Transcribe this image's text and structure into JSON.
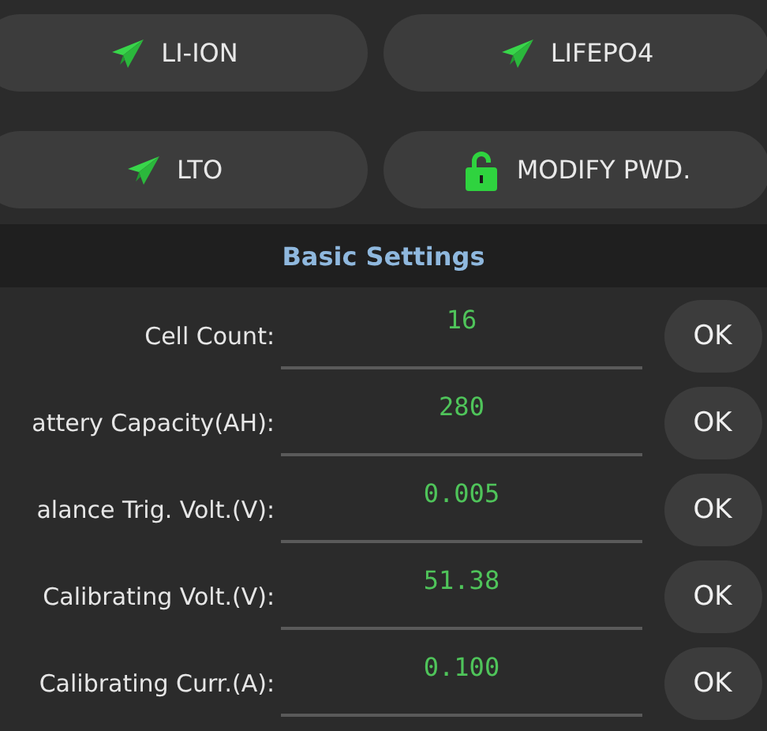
{
  "mode_buttons": [
    {
      "label": "LI-ION",
      "kind": "plane"
    },
    {
      "label": "LIFEPO4",
      "kind": "plane"
    },
    {
      "label": "LTO",
      "kind": "plane"
    },
    {
      "label": "MODIFY PWD.",
      "kind": "lock"
    }
  ],
  "section_title": "Basic Settings",
  "settings": [
    {
      "label": "Cell Count:",
      "value": "16",
      "button": "OK"
    },
    {
      "label": "attery Capacity(AH):",
      "value": "280",
      "button": "OK"
    },
    {
      "label": "alance Trig. Volt.(V):",
      "value": "0.005",
      "button": "OK"
    },
    {
      "label": "Calibrating Volt.(V):",
      "value": "51.38",
      "button": "OK"
    },
    {
      "label": "Calibrating Curr.(A):",
      "value": "0.100",
      "button": "OK"
    }
  ]
}
